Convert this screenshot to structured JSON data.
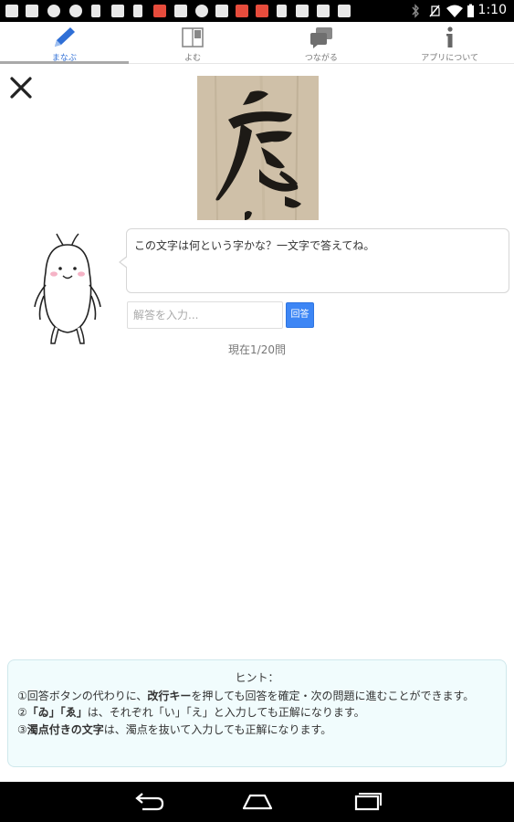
{
  "status_bar": {
    "time": "1:10",
    "icons": [
      "message-icon",
      "message-icon",
      "shield-icon",
      "location-icon",
      "phone-icon",
      "image-icon",
      "download-icon",
      "pocket-icon",
      "mail-icon",
      "shield-icon",
      "pocket-icon",
      "pocket-icon",
      "barcode-icon",
      "photo-icon",
      "camera-icon",
      "bluetooth-icon",
      "no-sim-icon",
      "wifi-icon",
      "battery-icon"
    ]
  },
  "tabs": [
    {
      "label": "まなぶ",
      "icon": "pencil-icon",
      "active": true
    },
    {
      "label": "よむ",
      "icon": "book-icon",
      "active": false
    },
    {
      "label": "つながる",
      "icon": "chat-icon",
      "active": false
    },
    {
      "label": "アプリについて",
      "icon": "info-icon",
      "active": false
    }
  ],
  "question": {
    "text": "この文字は何という字かな？一文字で答えてね。"
  },
  "answer": {
    "placeholder": "解答を入力...",
    "value": "",
    "button_label": "回答"
  },
  "progress": "現在1/20問",
  "hint": {
    "title": "ヒント：",
    "line1_a": "①回答ボタンの代わりに、",
    "line1_b": "改行キー",
    "line1_c": "を押しても回答を確定・次の問題に進むことができます。",
    "line2_a": "②",
    "line2_b": "「ゐ」「ゑ」",
    "line2_c": "は、それぞれ「い」「え」と入力しても正解になります。",
    "line3_a": "③",
    "line3_b": "濁点付きの文字",
    "line3_c": "は、濁点を抜いて入力しても正解になります。"
  },
  "nav": {
    "buttons": [
      "back-icon",
      "home-icon",
      "recents-icon"
    ]
  },
  "colors": {
    "accent": "#3d86f5",
    "active_tab": "#2f6fd6",
    "hint_bg": "#f1fcfd"
  }
}
